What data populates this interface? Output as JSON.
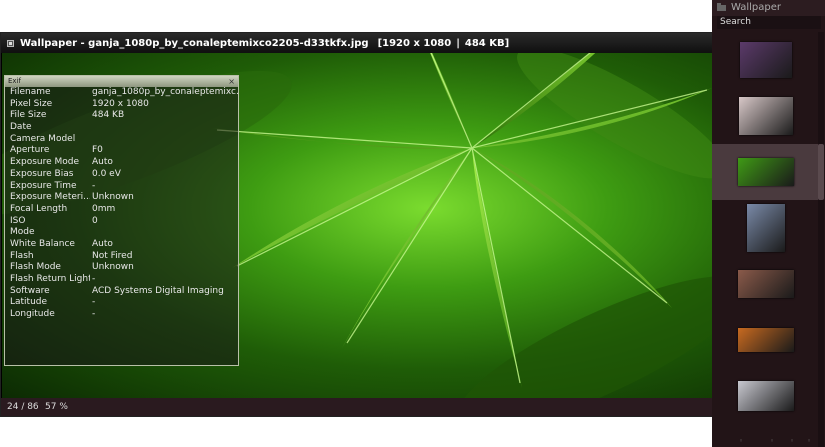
{
  "viewer": {
    "title": "Wallpaper - ganja_1080p_by_conaleptemixco2205-d33tkfx.jpg",
    "dimensions": "[1920 x 1080",
    "separator": "|",
    "size_label": "484 KB]",
    "status_index": "24 / 86",
    "status_zoom": "57 %"
  },
  "exif": {
    "header": "Exif",
    "close_label": "×",
    "rows": [
      {
        "key": "Filename",
        "value": "ganja_1080p_by_conaleptemixc..."
      },
      {
        "key": "Pixel Size",
        "value": "1920 x 1080"
      },
      {
        "key": "File Size",
        "value": "484 KB"
      },
      {
        "key": "Date",
        "value": ""
      },
      {
        "key": "Camera Model",
        "value": ""
      },
      {
        "key": "Aperture",
        "value": "F0"
      },
      {
        "key": "Exposure Mode",
        "value": "Auto"
      },
      {
        "key": "Exposure Bias",
        "value": "0.0 eV"
      },
      {
        "key": "Exposure Time",
        "value": "-"
      },
      {
        "key": "Exposure Meteri...",
        "value": "Unknown"
      },
      {
        "key": "Focal Length",
        "value": "0mm"
      },
      {
        "key": "ISO",
        "value": "0"
      },
      {
        "key": "Mode",
        "value": ""
      },
      {
        "key": "White Balance",
        "value": "Auto"
      },
      {
        "key": "Flash",
        "value": "Not Fired"
      },
      {
        "key": "Flash Mode",
        "value": "Unknown"
      },
      {
        "key": "Flash Return Light",
        "value": "-"
      },
      {
        "key": "Software",
        "value": "ACD Systems Digital Imaging"
      },
      {
        "key": "Latitude",
        "value": "-"
      },
      {
        "key": "Longitude",
        "value": "-"
      }
    ]
  },
  "sidebar": {
    "title": "Wallpaper",
    "search_label": "Search",
    "thumbnails": [
      {
        "name": "purple-lightning",
        "color": "#5b3a6a",
        "selected": false
      },
      {
        "name": "floral-pattern",
        "color": "#d8c8c8",
        "selected": false
      },
      {
        "name": "green-leaf",
        "color": "#3f9a15",
        "selected": true
      },
      {
        "name": "anime-portrait",
        "color": "#7a8aa8",
        "selected": false
      },
      {
        "name": "people-collage",
        "color": "#8a5a4a",
        "selected": false
      },
      {
        "name": "orange-stripes",
        "color": "#c86a20",
        "selected": false
      },
      {
        "name": "white-bird",
        "color": "#c8c8d0",
        "selected": false
      }
    ]
  },
  "colors": {
    "sidebar_bg": "#221417",
    "titlebar_text": "#ffffff",
    "accent_green": "#6fcf2a"
  }
}
